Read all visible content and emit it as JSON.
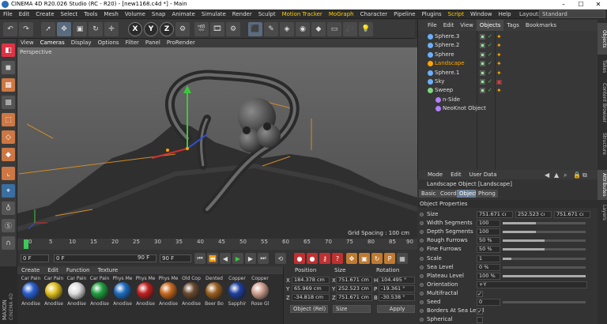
{
  "window": {
    "title": "CINEMA 4D R20.026 Studio (RC - R20) - [new1168.c4d *] - Main"
  },
  "menubar": {
    "items": [
      "File",
      "Edit",
      "Create",
      "Select",
      "Tools",
      "Mesh",
      "Volume",
      "Snap",
      "Animate",
      "Simulate",
      "Render",
      "Sculpt",
      "Motion Tracker",
      "MoGraph",
      "Character",
      "Pipeline",
      "Plugins",
      "Script",
      "Window",
      "Help"
    ],
    "layout_label": "Layout:",
    "layout_value": "Standard"
  },
  "toolbar": {
    "x": "X",
    "y": "Y",
    "z": "Z"
  },
  "viewport": {
    "menu": [
      "View",
      "Cameras",
      "Display",
      "Options",
      "Filter",
      "Panel",
      "ProRender"
    ],
    "label": "Perspective",
    "grid_spacing": "Grid Spacing : 100 cm"
  },
  "timeline": {
    "ticks": [
      "0",
      "5",
      "10",
      "15",
      "20",
      "25",
      "30",
      "35",
      "40",
      "45",
      "50",
      "55",
      "60",
      "65",
      "70",
      "75",
      "80",
      "85",
      "90"
    ]
  },
  "transport": {
    "start": "0 F",
    "current": "0 F",
    "end": "90 F",
    "end2": "90 F"
  },
  "materials": {
    "menu": [
      "Create",
      "Edit",
      "Function",
      "Texture"
    ],
    "items": [
      {
        "top": "Car Pain",
        "bottom": "Anodise",
        "color": "#2a5fd0"
      },
      {
        "top": "Car Pain",
        "bottom": "Anodise",
        "color": "#e0c020"
      },
      {
        "top": "Car Pain",
        "bottom": "Anodise",
        "color": "#dedede"
      },
      {
        "top": "Car Pain",
        "bottom": "Anodise",
        "color": "#20a040"
      },
      {
        "top": "Phys Me",
        "bottom": "Anodise",
        "color": "#1e6cc0"
      },
      {
        "top": "Phys Me",
        "bottom": "Anodise",
        "color": "#c02020"
      },
      {
        "top": "Phys Me",
        "bottom": "Anodise",
        "color": "#c86a20"
      },
      {
        "top": "Old Cop",
        "bottom": "Anodise",
        "color": "#6a4a30"
      },
      {
        "top": "Dented",
        "bottom": "Beer Bo",
        "color": "#9a6020"
      },
      {
        "top": "Copper",
        "bottom": "Sapphir",
        "color": "#2040a0"
      },
      {
        "top": "Copper",
        "bottom": "Rose Gl",
        "color": "#d0a090"
      }
    ]
  },
  "coordinates": {
    "headers": [
      "Position",
      "Size",
      "Rotation"
    ],
    "axes": [
      "X",
      "Y",
      "Z"
    ],
    "rot_axes": [
      "H",
      "P",
      "B"
    ],
    "position": [
      "184.378 cm",
      "65.969 cm",
      "-34.818 cm"
    ],
    "size": [
      "751.671 cm",
      "252.523 cm",
      "751.671 cm"
    ],
    "rotation": [
      "104.495 °",
      "-19.361 °",
      "-30.538 °"
    ],
    "mode": "Object (Rel)",
    "size_mode": "Size",
    "apply": "Apply"
  },
  "objects": {
    "menu": [
      "File",
      "Edit",
      "View",
      "Objects",
      "Tags",
      "Bookmarks"
    ],
    "items": [
      {
        "name": "Sphere.3",
        "color": "#6ab0ff"
      },
      {
        "name": "Sphere.2",
        "color": "#6ab0ff"
      },
      {
        "name": "Sphere",
        "color": "#6ab0ff"
      },
      {
        "name": "Landscape",
        "color": "#ffa500"
      },
      {
        "name": "Sphere.1",
        "color": "#6ab0ff"
      },
      {
        "name": "Sky",
        "color": "#6ab0ff"
      },
      {
        "name": "Sweep",
        "color": "#7fd67f"
      },
      {
        "name": "n-Side",
        "color": "#b080ff"
      },
      {
        "name": "NeoKnot Object",
        "color": "#b080ff"
      }
    ]
  },
  "right_tabs": [
    "Objects",
    "Takes",
    "Content Browser",
    "Structure",
    "Attributes",
    "Layers"
  ],
  "attributes": {
    "menu": [
      "Mode",
      "Edit",
      "User Data"
    ],
    "title": "Landscape Object [Landscape]",
    "tabs": [
      "Basic",
      "Coord.",
      "Object",
      "Phong"
    ],
    "section": "Object Properties",
    "rows": [
      {
        "label": "Size",
        "v1": "751.671 cı",
        "v2": "252.523 cı",
        "v3": "751.671 cı"
      },
      {
        "label": "Width Segments",
        "value": "100",
        "bar": 0.4
      },
      {
        "label": "Depth Segments",
        "value": "100",
        "bar": 0.4
      },
      {
        "label": "Rough Furrows",
        "value": "50 %",
        "bar": 0.5
      },
      {
        "label": "Fine Furrows",
        "value": "50 %",
        "bar": 0.5
      },
      {
        "label": "Scale",
        "value": "1",
        "bar": 0.1
      },
      {
        "label": "Sea Level",
        "value": "0 %",
        "bar": 0.0
      },
      {
        "label": "Plateau Level",
        "value": "100 %",
        "bar": 1.0
      },
      {
        "label": "Orientation",
        "value": "+Y"
      },
      {
        "label": "Multifractal",
        "check": "✓"
      },
      {
        "label": "Seed",
        "value": "0",
        "bar": 0.0
      },
      {
        "label": "Borders At Sea Level",
        "check": "✓"
      },
      {
        "label": "Spherical",
        "check": ""
      }
    ]
  }
}
